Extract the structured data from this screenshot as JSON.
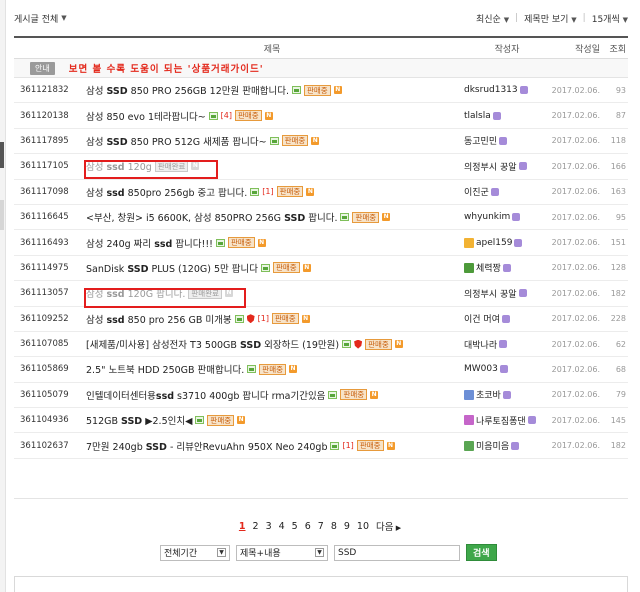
{
  "toolbar": {
    "category_filter": "게시글 전체",
    "sort": "최신순",
    "view_mode": "제목만 보기",
    "per_page": "15개씩"
  },
  "table": {
    "headers": {
      "title": "제목",
      "writer": "작성자",
      "date": "작성일",
      "views": "조회"
    },
    "notice": {
      "tag": "안내",
      "title": "보면 볼 수록 도움이 되는 '상품거래가이드'"
    },
    "rows": [
      {
        "num": "361121832",
        "pre": "삼성 ",
        "kw": "SSD",
        "post": " 850 PRO 256GB 12만원 판매합니다.",
        "badge": "판매중",
        "writer": "dksrud1313",
        "date": "2017.02.06.",
        "views": "93"
      },
      {
        "num": "361120138",
        "pre": "삼성 850 evo 1테라팝니다~",
        "kw": "",
        "post": "",
        "comments": "[4]",
        "badge": "판매중",
        "writer": "tlalsla",
        "date": "2017.02.06.",
        "views": "87"
      },
      {
        "num": "361117895",
        "pre": "삼성 ",
        "kw": "SSD",
        "post": " 850 PRO 512G 새제품 팝니다~",
        "badge": "판매중",
        "writer": "동고민민",
        "date": "2017.02.06.",
        "views": "118"
      },
      {
        "num": "361117105",
        "pre": "삼성 ",
        "kw": "ssd",
        "post": " 120g",
        "badge": "판매완료",
        "writer": "의정부시 꿍알",
        "date": "2017.02.06.",
        "views": "166"
      },
      {
        "num": "361117098",
        "pre": "삼성 ",
        "kw": "ssd",
        "post": " 850pro 256gb 중고 팝니다.",
        "comments": "[1]",
        "badge": "판매중",
        "writer": "이진군",
        "date": "2017.02.06.",
        "views": "163"
      },
      {
        "num": "361116645",
        "pre": "<부산, 창원> i5 6600K, 삼성 850PRO 256G ",
        "kw": "SSD",
        "post": " 팝니다.",
        "badge": "판매중",
        "writer": "whyunkim",
        "date": "2017.02.06.",
        "views": "95"
      },
      {
        "num": "361116493",
        "pre": "삼성 240g 짜리 ",
        "kw": "ssd",
        "post": " 팝니다!!!",
        "badge": "판매중",
        "writer": "apel159",
        "date": "2017.02.06.",
        "views": "151"
      },
      {
        "num": "361114975",
        "pre": "SanDisk ",
        "kw": "SSD",
        "post": " PLUS (120G) 5만 팝니다",
        "badge": "판매중",
        "writer": "체력짱",
        "date": "2017.02.06.",
        "views": "128"
      },
      {
        "num": "361113057",
        "pre": "삼성 ",
        "kw": "ssd",
        "post": " 120G 팝니다.",
        "badge": "판매완료",
        "writer": "의정부시 꿍알",
        "date": "2017.02.06.",
        "views": "182"
      },
      {
        "num": "361109252",
        "pre": "삼성 ",
        "kw": "ssd",
        "post": " 850 pro 256 GB 미개봉",
        "comments": "[1]",
        "badge": "판매중",
        "writer": "이건 머여",
        "date": "2017.02.06.",
        "views": "228"
      },
      {
        "num": "361107085",
        "pre": "[새제품/미사용] 삼성전자 T3 500GB ",
        "kw": "SSD",
        "post": " 외장하드 (19만원)",
        "badge": "판매중",
        "writer": "대박나라",
        "date": "2017.02.06.",
        "views": "62"
      },
      {
        "num": "361105869",
        "pre": "2.5\" 노트북 HDD 250GB 판매합니다.",
        "kw": "",
        "post": "",
        "badge": "판매중",
        "writer": "MW003",
        "date": "2017.02.06.",
        "views": "68"
      },
      {
        "num": "361105079",
        "pre": "인텔데이터센터용",
        "kw": "ssd",
        "post": " s3710 400gb 팝니다 rma기간있음",
        "badge": "판매중",
        "writer": "초코바",
        "date": "2017.02.06.",
        "views": "79"
      },
      {
        "num": "361104936",
        "pre": "512GB ",
        "kw": "SSD",
        "post": " ▶2.5인치◀",
        "badge": "판매중",
        "writer": "나루토짐퐁댄",
        "date": "2017.02.06.",
        "views": "145"
      },
      {
        "num": "361102637",
        "pre": "7만원 240gb ",
        "kw": "SSD",
        "post": " - 리뷰안RevuAhn 950X Neo 240gb",
        "comments": "[1]",
        "badge": "판매중",
        "writer": "미음미음",
        "date": "2017.02.06.",
        "views": "182"
      }
    ]
  },
  "pagination": {
    "current": "1",
    "pages": [
      "2",
      "3",
      "4",
      "5",
      "6",
      "7",
      "8",
      "9",
      "10"
    ],
    "next": "다음"
  },
  "search": {
    "period": "전체기간",
    "scope": "제목+내용",
    "query": "SSD",
    "button": "검색"
  },
  "colors": {
    "sale_badge": "#e79a3c",
    "highlight": "#e31d1d",
    "search_button": "#3ea74a",
    "notice_title": "#e3291c"
  }
}
